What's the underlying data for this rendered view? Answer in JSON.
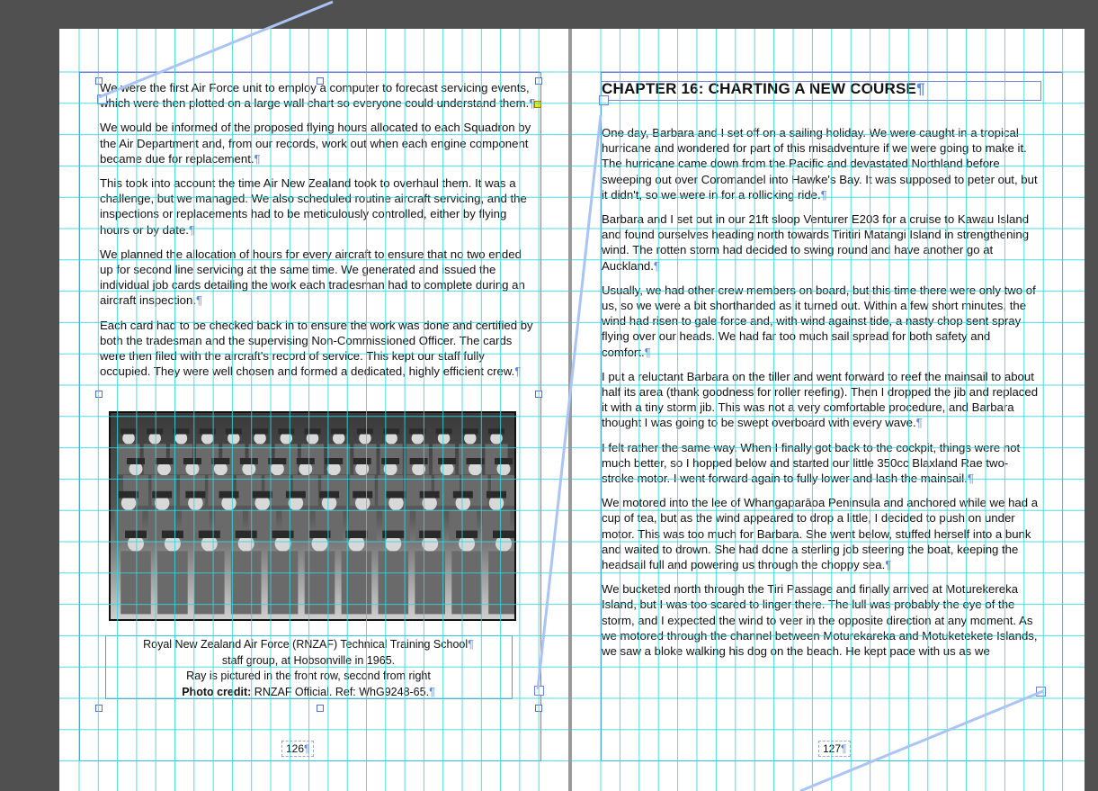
{
  "left_page": {
    "paragraphs": [
      "We were the first Air Force unit to employ a computer to forecast servicing events, which were then plotted on a large wall chart so everyone could understand them.",
      "We would be informed of the proposed flying hours allocated to each Squadron by the Air Department and, from our records, work out when each engine component became due for replacement.",
      "This took into account the time Air New Zealand took to overhaul them. It was a challenge, but we managed. We also scheduled routine aircraft servicing, and the inspections or replacements had to be meticulously controlled, either by flying hours or by date.",
      "We planned the allocation of hours for every aircraft to ensure that no two ended up for second line servicing at the same time. We generated and issued the individual job cards detailing the work each tradesman had to complete during an aircraft inspection.",
      "Each card had to be checked back in to ensure the work was done and certified by both the tradesman and the supervising Non-Commissioned Officer. The cards were then filed with the aircraft's record of service. This kept our staff fully occupied. They were well chosen and formed a dedicated, highly efficient crew."
    ],
    "caption": {
      "line1": "Royal New Zealand Air Force (RNZAF) Technical Training School",
      "line2": "staff group, at Hobsonville in 1965.",
      "line3": "Ray is pictured in the front row, second from right",
      "credit_label": "Photo credit:",
      "credit_text": " RNZAF Official. Ref: WhG9248-65."
    },
    "page_number": "126"
  },
  "right_page": {
    "heading": "CHAPTER 16: CHARTING A NEW COURSE",
    "paragraphs": [
      "One day, Barbara and I set off on a sailing holiday. We were caught in a tropical hurricane and wondered for part of this misadventure if we were going to make it. The hurricane came down from the Pacific and devastated Northland before sweeping out over Coromandel into Hawke's Bay. It was supposed to peter out, but it didn't, so we were in for a rollicking ride.",
      "Barbara and I set out in our 21ft sloop Venturer E203 for a cruise to Kawau Island and found ourselves heading north towards Tiritiri Matangi Island in strengthening wind. The rotten storm had decided to swing round and have another go at Auckland.",
      "Usually, we had other crew members on board, but this time there were only two of us, so we were a bit shorthanded as it turned out. Within a few short minutes, the wind had risen to gale force and, with wind against tide, a nasty chop sent spray flying over our heads. We had far too much sail spread for both safety and comfort.",
      "I put a reluctant Barbara on the tiller and went forward to reef the mainsail to about half its area (thank goodness for roller reefing). Then I dropped the jib and replaced it with a tiny storm jib. This was not a very comfortable procedure, and Barbara thought I was going to be swept overboard with every wave.",
      "I felt rather the same way. When I finally got back to the cockpit, things were not much better, so I hopped below and started our little 350cc Blaxland Rae two-stroke motor. I went forward again to fully lower and lash the mainsail.",
      "We motored into the lee of Whangaparāoa Peninsula and anchored while we had a cup of tea, but as the wind appeared to drop a little, I decided to push on under motor. This was too much for Barbara. She went below, stuffed herself into a bunk and waited to drown. She had done a sterling job steering the boat, keeping the headsail full and powering us through the choppy sea.",
      "We bucketed north through the Tiri Passage and finally arrived at Moturekereka Island, but I was too scared to linger there. The lull was probably the eye of the storm, and I expected the wind to veer in the opposite direction at any moment. As we motored through the channel between Moturekareka and Motuketekete Islands, we saw a bloke walking his dog on the beach. He kept pace with us as we bucketed through the short, choppy waves. We waved"
    ],
    "page_number": "127"
  },
  "ui": {
    "pilcrow": "¶",
    "grid_color": "#2ed8e0",
    "frame_color": "#6b7fe0",
    "threadline_color": "#a9c4f5",
    "pasteboard_color": "#505050"
  }
}
